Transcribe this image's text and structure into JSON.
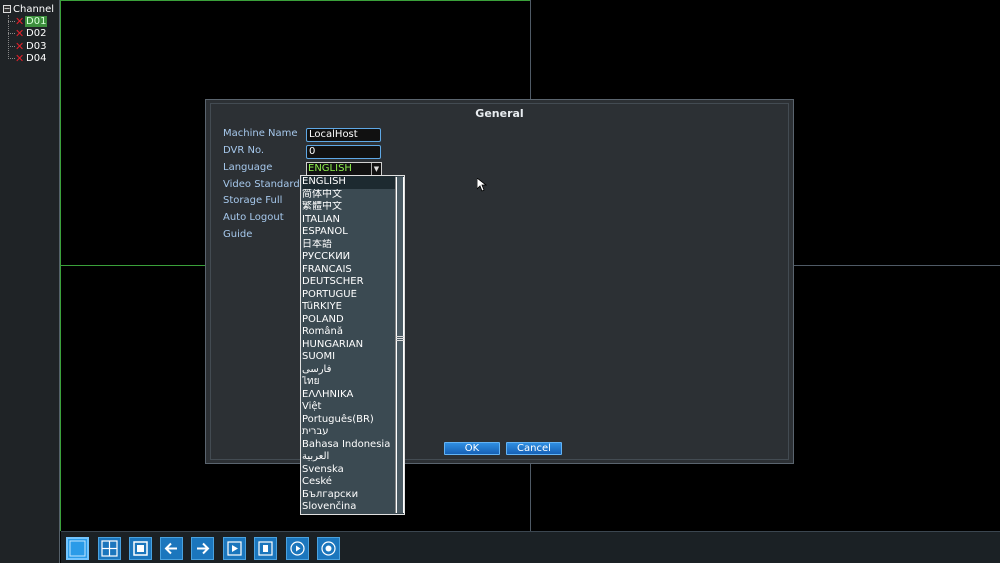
{
  "channel_panel": {
    "header": "Channel",
    "items": [
      {
        "label": "D01",
        "selected": true
      },
      {
        "label": "D02",
        "selected": false
      },
      {
        "label": "D03",
        "selected": false
      },
      {
        "label": "D04",
        "selected": false
      }
    ]
  },
  "dialog": {
    "title": "General",
    "fields": {
      "machine_name_label": "Machine Name",
      "machine_name_value": "LocalHost",
      "dvr_no_label": "DVR No.",
      "dvr_no_value": "0",
      "language_label": "Language",
      "language_value": "ENGLISH",
      "video_standard_label": "Video Standard",
      "storage_full_label": "Storage Full",
      "auto_logout_label": "Auto Logout",
      "guide_label": "Guide"
    },
    "ok_label": "OK",
    "cancel_label": "Cancel"
  },
  "language_options": [
    "ENGLISH",
    "简体中文",
    "繁體中文",
    "ITALIAN",
    "ESPAÑOL",
    "日本語",
    "РУССКИЙ",
    "FRANCAIS",
    "DEUTSCHER",
    "PORTUGUÊ",
    "TüRKİYE",
    "POLAND",
    "Română",
    "HUNGARIAN",
    "SUOMI",
    "فارسی",
    "ไทย",
    "ΕΛΛΗΝΙΚΑ",
    "Việt",
    "Português(BR)",
    "עברית",
    "Bahasa Indonesia",
    "العربية",
    "Svenska",
    "České",
    "Български",
    "Slovenčina"
  ],
  "toolbar": {
    "buttons": [
      "single-view-icon",
      "quad-view-icon",
      "stop-icon",
      "arrow-left-icon",
      "arrow-right-icon",
      "play-frame-icon",
      "record-frame-icon",
      "play-circle-icon",
      "record-circle-icon"
    ]
  },
  "colors": {
    "accent_blue": "#1b76bd",
    "label_blue": "#a6c8ec",
    "selected_green": "#8ef04d",
    "error_red": "#e0202a"
  }
}
